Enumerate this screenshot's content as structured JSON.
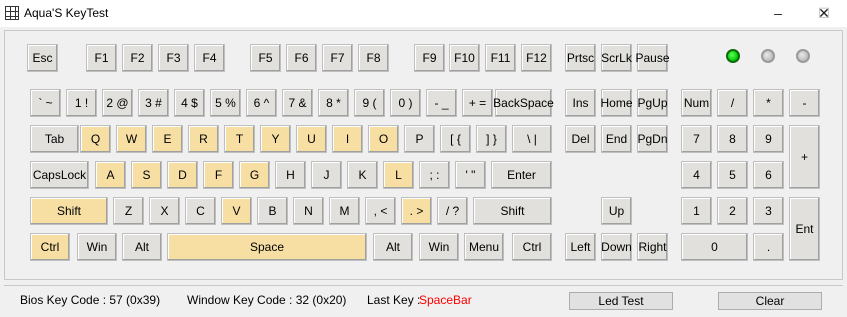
{
  "window": {
    "title": "Aqua'S KeyTest",
    "minimize": "–",
    "maximize": "☐",
    "close": "✕"
  },
  "keys": {
    "esc": "Esc",
    "f1": "F1",
    "f2": "F2",
    "f3": "F3",
    "f4": "F4",
    "f5": "F5",
    "f6": "F6",
    "f7": "F7",
    "f8": "F8",
    "f9": "F9",
    "f10": "F10",
    "f11": "F11",
    "f12": "F12",
    "prtsc": "Prtsc",
    "scrlk": "ScrLk",
    "pause": "Pause",
    "backtick": "` ~",
    "d1": "1 !",
    "d2": "2 @",
    "d3": "3 #",
    "d4": "4 $",
    "d5": "5 %",
    "d6": "6 ^",
    "d7": "7 &",
    "d8": "8 *",
    "d9": "9 (",
    "d0": "0 )",
    "minus": "- _",
    "equals": "+ =",
    "backspace": "BackSpace",
    "ins": "Ins",
    "home": "Home",
    "pgup": "PgUp",
    "num": "Num",
    "kp_div": "/",
    "kp_mul": "*",
    "kp_sub": "-",
    "tab": "Tab",
    "q": "Q",
    "w": "W",
    "e": "E",
    "r": "R",
    "t": "T",
    "y": "Y",
    "u": "U",
    "i": "I",
    "o": "O",
    "p": "P",
    "lbracket": "[ {",
    "rbracket": "] }",
    "backslash": "\\ |",
    "del": "Del",
    "end": "End",
    "pgdn": "PgDn",
    "kp7": "7",
    "kp8": "8",
    "kp9": "9",
    "kp_add": "+",
    "capslock": "CapsLock",
    "a": "A",
    "s": "S",
    "d": "D",
    "f": "F",
    "g": "G",
    "h": "H",
    "j": "J",
    "k": "K",
    "l": "L",
    "semicolon": "; :",
    "quote": "' \"",
    "enter": "Enter",
    "kp4": "4",
    "kp5": "5",
    "kp6": "6",
    "lshift": "Shift",
    "z": "Z",
    "x": "X",
    "c": "C",
    "v": "V",
    "b": "B",
    "n": "N",
    "m": "M",
    "comma": ", <",
    "period": ". >",
    "slash": "/ ?",
    "rshift": "Shift",
    "up": "Up",
    "kp1": "1",
    "kp2": "2",
    "kp3": "3",
    "kp_enter": "Ent",
    "lctrl": "Ctrl",
    "lwin": "Win",
    "lalt": "Alt",
    "space": "Space",
    "ralt": "Alt",
    "rwin": "Win",
    "menu": "Menu",
    "rctrl": "Ctrl",
    "left": "Left",
    "down": "Down",
    "right": "Right",
    "kp0": "0",
    "kp_dot": "."
  },
  "pressed_keys": [
    "q",
    "w",
    "e",
    "r",
    "t",
    "y",
    "u",
    "i",
    "o",
    "a",
    "s",
    "d",
    "f",
    "g",
    "l",
    "v",
    "period",
    "lshift",
    "lctrl",
    "space"
  ],
  "leds": {
    "num_lock": "on",
    "caps_lock": "off",
    "scroll_lock": "off"
  },
  "status": {
    "bios_label": "Bios Key Code : 57 (0x39)",
    "window_label": "Window Key Code : 32 (0x20)",
    "last_key_label": "Last Key :",
    "last_key_value": "SpaceBar",
    "last_key_color": "#ff0000"
  },
  "buttons": {
    "led_test": "Led Test",
    "clear": "Clear"
  },
  "colors": {
    "pressed": "#f7dfa4",
    "normal": "#e1e0dc",
    "led_on": "#00c800"
  }
}
